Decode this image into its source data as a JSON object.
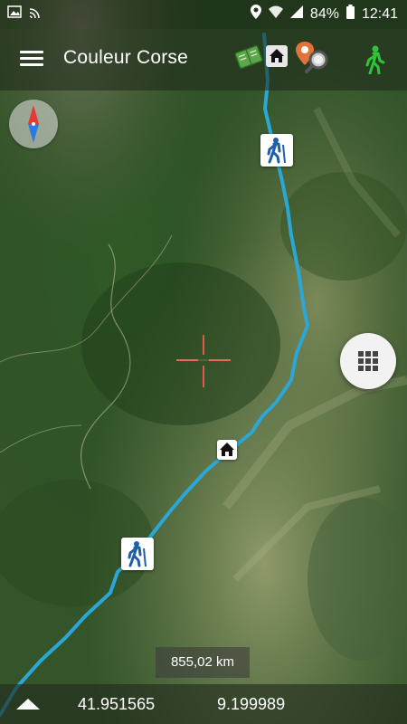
{
  "status_bar": {
    "battery": "84%",
    "time": "12:41",
    "icons": [
      "image-icon",
      "cast-icon",
      "location-icon",
      "wifi-icon",
      "signal-icon",
      "battery-icon"
    ]
  },
  "app_bar": {
    "title": "Couleur Corse",
    "actions": [
      "map-book-icon",
      "home-icon",
      "poi-search-icon",
      "hiker-mode-icon"
    ],
    "accent_green": "#2fc53a"
  },
  "map": {
    "type": "satellite",
    "track_color": "#2aa7d6",
    "distance": "855,02 km",
    "markers": [
      "hiker-marker",
      "hiker-marker",
      "home-marker",
      "hiker-marker"
    ]
  },
  "coordinates": {
    "latitude": "41.951565",
    "longitude": "9.199989"
  }
}
